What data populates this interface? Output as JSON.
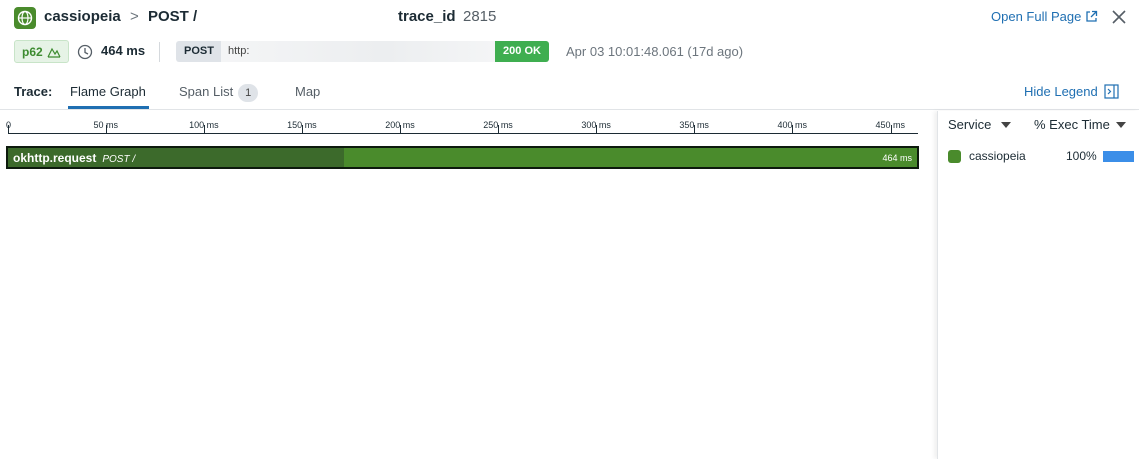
{
  "header": {
    "service": "cassiopeia",
    "crumb_separator": ">",
    "resource": "POST /",
    "trace_label": "trace_id",
    "trace_id": "2815",
    "open_full_page": "Open Full Page",
    "service_icon": "globe-icon",
    "close_icon": "close-icon"
  },
  "meta": {
    "percentile": "p62",
    "duration": "464 ms",
    "method": "POST",
    "url": "http:",
    "status": "200 OK",
    "timestamp": "Apr 03 10:01:48.061 (17d ago)"
  },
  "tabs": {
    "label": "Trace:",
    "items": [
      {
        "label": "Flame Graph",
        "active": true
      },
      {
        "label": "Span List",
        "badge": "1"
      },
      {
        "label": "Map"
      }
    ],
    "hide_legend": "Hide Legend"
  },
  "flame": {
    "axis_ticks": [
      "0",
      "50 ms",
      "100 ms",
      "150 ms",
      "200 ms",
      "250 ms",
      "300 ms",
      "350 ms",
      "400 ms",
      "450 ms"
    ],
    "tick_ms": [
      0,
      50,
      100,
      150,
      200,
      250,
      300,
      350,
      400,
      450
    ],
    "total_ms": 464,
    "span": {
      "name": "okhttp.request",
      "resource": "POST  /",
      "duration": "464 ms",
      "self_time_fraction": 0.37
    }
  },
  "legend": {
    "col_service": "Service",
    "col_exec": "% Exec Time",
    "rows": [
      {
        "service": "cassiopeia",
        "pct": "100%",
        "pct_value": 100,
        "color": "#4a8b2c"
      }
    ]
  },
  "colors": {
    "accent": "#1f6fb2",
    "service_green": "#4a8b2c",
    "status_green": "#3fae50",
    "exec_bar": "#3b8ee8"
  }
}
